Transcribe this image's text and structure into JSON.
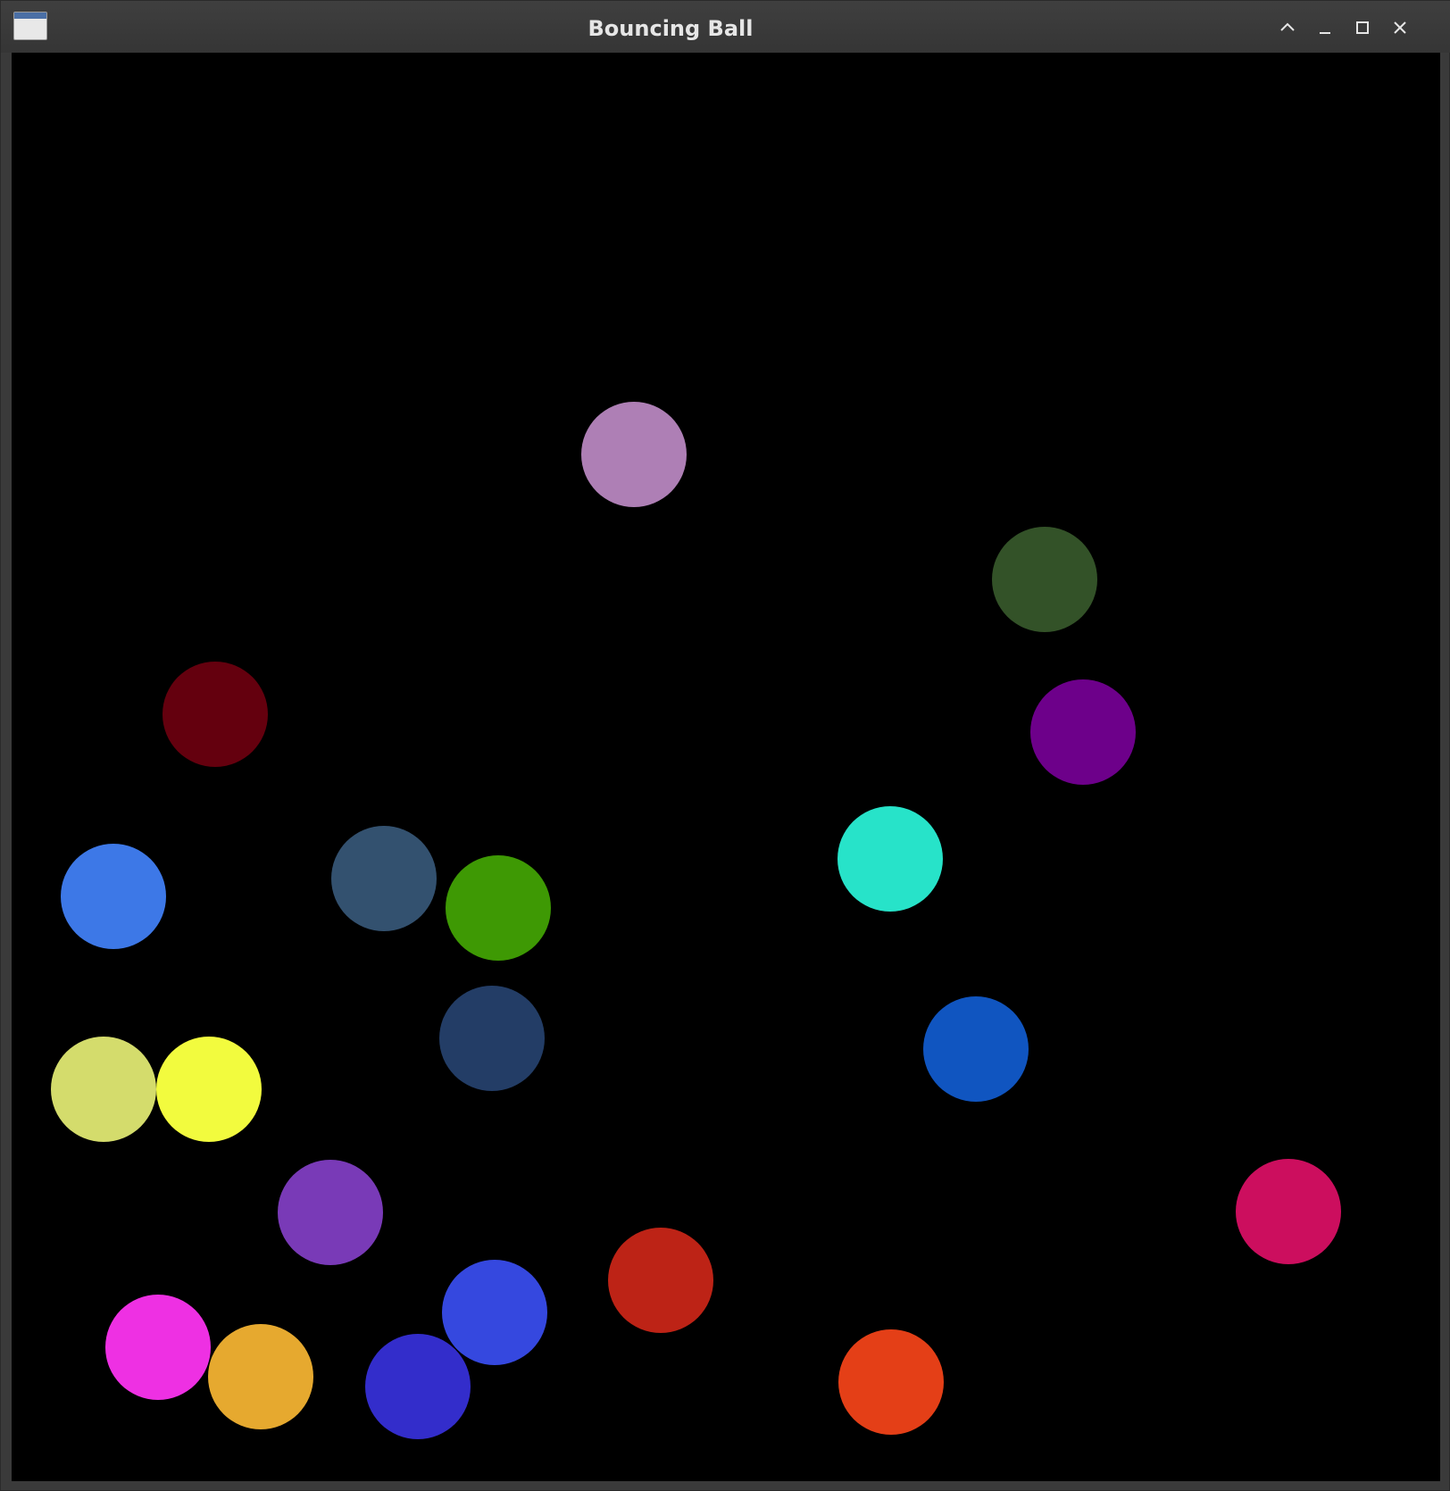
{
  "window": {
    "title": "Bouncing Ball",
    "icon": "application-window-icon",
    "controls": [
      {
        "name": "shade-button",
        "icon": "chevron-up-icon"
      },
      {
        "name": "minimize-button",
        "icon": "minimize-icon"
      },
      {
        "name": "maximize-button",
        "icon": "maximize-icon"
      },
      {
        "name": "close-button",
        "icon": "close-icon"
      }
    ]
  },
  "canvas": {
    "background": "#000000",
    "balls": [
      {
        "color": "#ae7fb5"
      },
      {
        "color": "#335228"
      },
      {
        "color": "#64000e"
      },
      {
        "color": "#6d008a"
      },
      {
        "color": "#27e3c9"
      },
      {
        "color": "#3d78e7"
      },
      {
        "color": "#33516f"
      },
      {
        "color": "#3e9904"
      },
      {
        "color": "#233d66"
      },
      {
        "color": "#1055c0"
      },
      {
        "color": "#d4dc6c"
      },
      {
        "color": "#f2fb3e"
      },
      {
        "color": "#793ab7"
      },
      {
        "color": "#cc0e5e"
      },
      {
        "color": "#bd2316"
      },
      {
        "color": "#3548df"
      },
      {
        "color": "#ee30e3"
      },
      {
        "color": "#e6a92f"
      },
      {
        "color": "#332dcb"
      },
      {
        "color": "#e43f17"
      }
    ]
  }
}
